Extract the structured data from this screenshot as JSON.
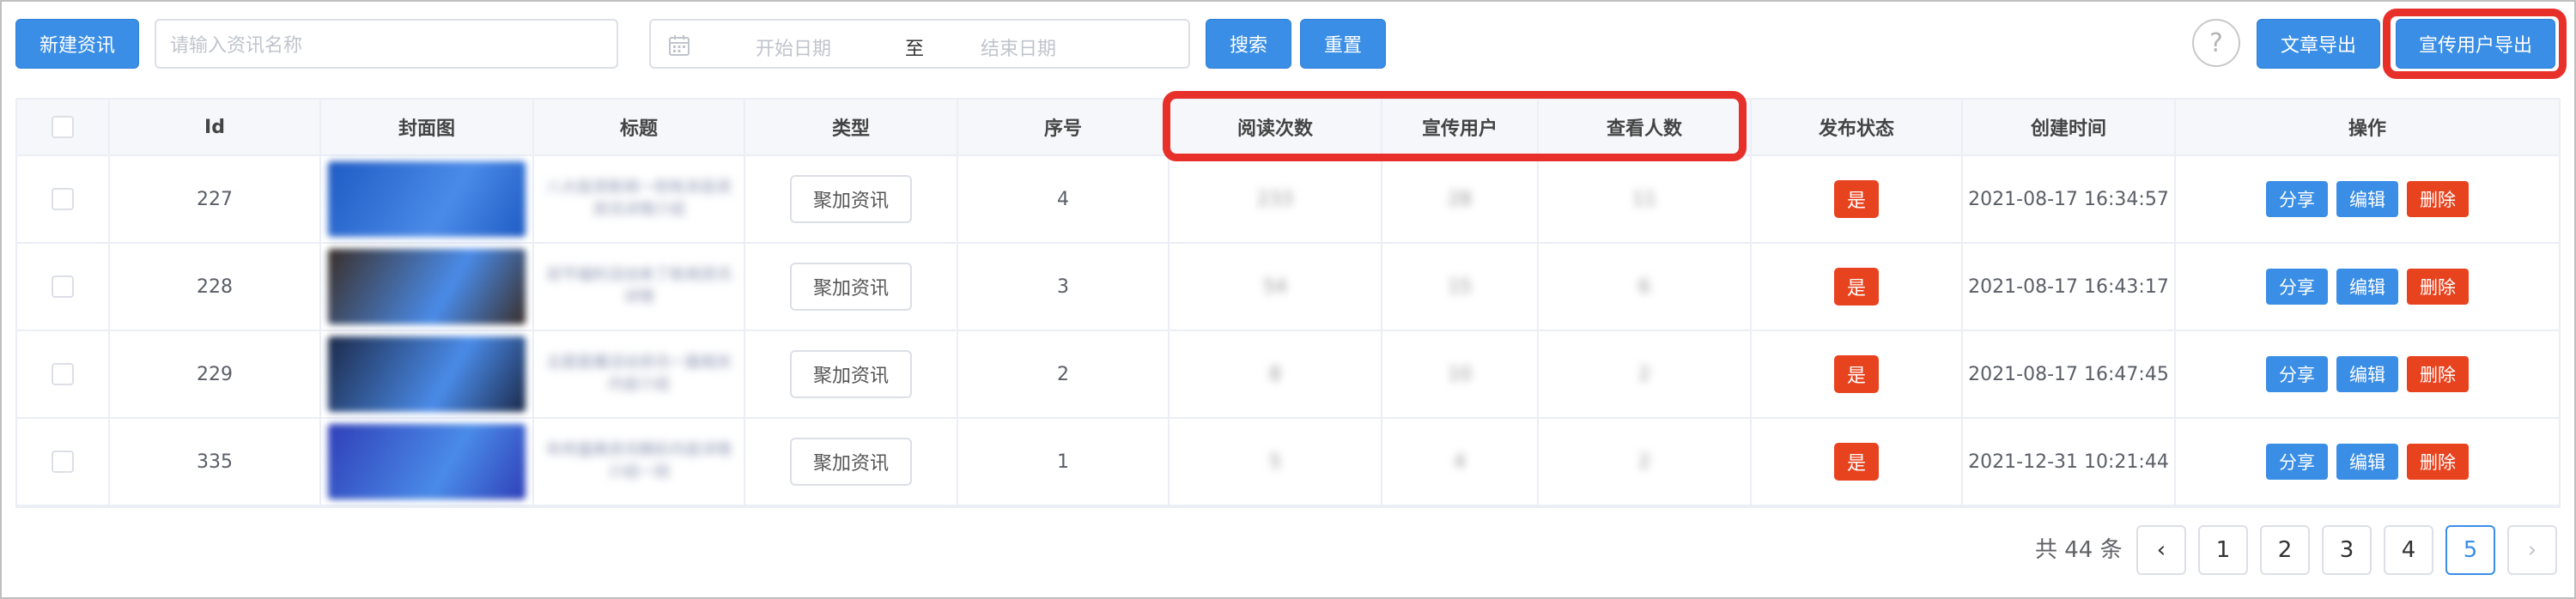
{
  "toolbar": {
    "new_button": "新建资讯",
    "search_placeholder": "请输入资讯名称",
    "start_date_placeholder": "开始日期",
    "date_separator": "至",
    "end_date_placeholder": "结束日期",
    "search_button": "搜索",
    "reset_button": "重置",
    "help_symbol": "?",
    "export_articles_button": "文章导出",
    "export_promo_users_button": "宣传用户导出"
  },
  "table": {
    "columns": [
      "Id",
      "封面图",
      "标题",
      "类型",
      "序号",
      "阅读次数",
      "宣传用户",
      "查看人数",
      "发布状态",
      "创建时间",
      "操作"
    ],
    "rows": [
      {
        "id": "227",
        "cover_color": "#1f5bc4",
        "title": "八大投资新闻一则有关投资资讯详情介绍",
        "type": "聚加资讯",
        "order": "4",
        "reads": "233",
        "promo_users": "28",
        "viewers": "11",
        "status": "是",
        "created": "2021-08-17 16:34:57"
      },
      {
        "id": "228",
        "cover_color": "#3a2f2a",
        "title": "双节福利活动来了新闻资讯详情",
        "type": "聚加资讯",
        "order": "3",
        "reads": "54",
        "promo_users": "15",
        "viewers": "6",
        "status": "是",
        "created": "2021-08-17 16:43:17"
      },
      {
        "id": "229",
        "cover_color": "#1c2a4a",
        "title": "主题直播活动资讯一篇相关内容介绍",
        "type": "聚加资讯",
        "order": "2",
        "reads": "8",
        "promo_users": "10",
        "viewers": "2",
        "status": "是",
        "created": "2021-08-17 16:47:45"
      },
      {
        "id": "335",
        "cover_color": "#2f3fb8",
        "title": "年终盛典资讯精彩内容详情介绍一则",
        "type": "聚加资讯",
        "order": "1",
        "reads": "5",
        "promo_users": "4",
        "viewers": "2",
        "status": "是",
        "created": "2021-12-31 10:21:44"
      }
    ],
    "actions": {
      "share": "分享",
      "edit": "编辑",
      "delete": "删除"
    }
  },
  "pagination": {
    "total": "共 44 条",
    "prev": "‹",
    "next": "›",
    "pages": [
      "1",
      "2",
      "3",
      "4",
      "5"
    ],
    "current": "5"
  },
  "icons": {
    "calendar": "calendar-icon"
  },
  "colors": {
    "primary": "#3a8ee6",
    "danger": "#e8431f",
    "highlight": "#e8302a"
  }
}
